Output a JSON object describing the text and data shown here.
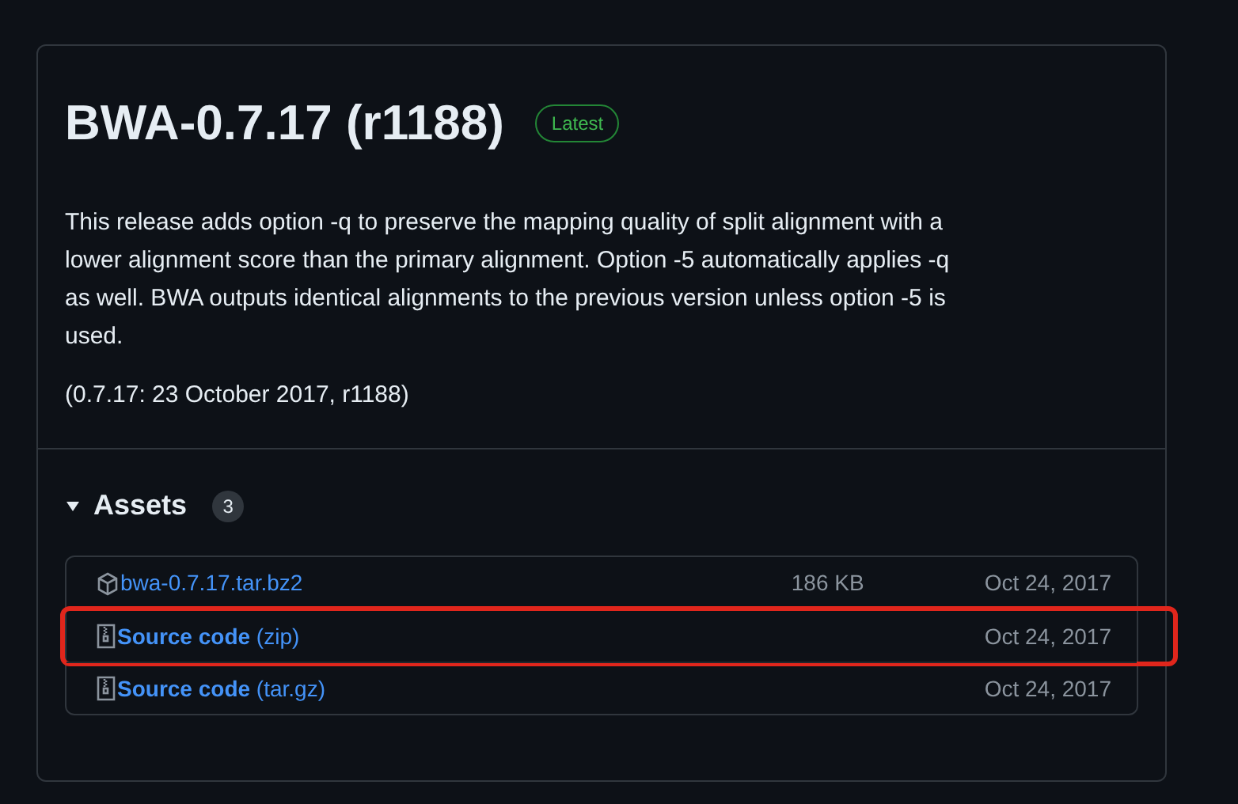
{
  "release": {
    "title": "BWA-0.7.17 (r1188)",
    "badge": "Latest",
    "description": "This release adds option -q to preserve the mapping quality of split alignment with a lower alignment score than the primary alignment. Option -5 automatically applies -q as well. BWA outputs identical alignments to the previous version unless option -5 is used.",
    "date_note": "(0.7.17: 23 October 2017, r1188)"
  },
  "assets": {
    "heading": "Assets",
    "count": "3",
    "expanded": true,
    "items": [
      {
        "kind": "package",
        "name": "bwa-0.7.17.tar.bz2",
        "size": "186 KB",
        "date": "Oct 24, 2017",
        "highlighted": false
      },
      {
        "kind": "archive",
        "name": "**Source code** (zip)",
        "date": "Oct 24, 2017",
        "highlighted": true
      },
      {
        "kind": "archive",
        "name": "**Source code** (tar.gz)",
        "date": "Oct 24, 2017",
        "highlighted": false
      }
    ]
  }
}
